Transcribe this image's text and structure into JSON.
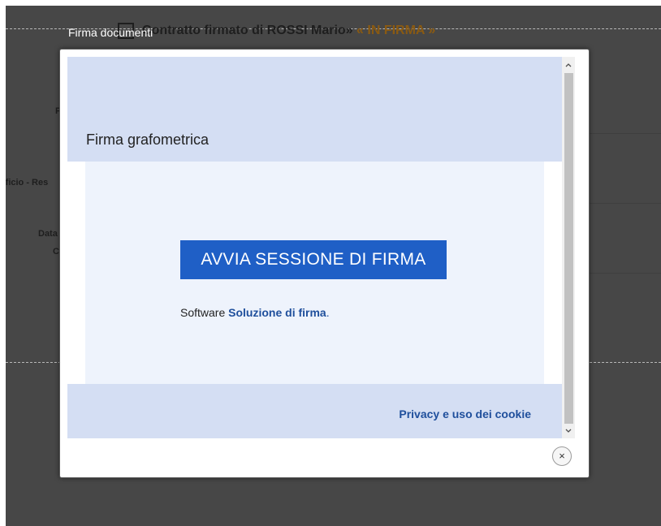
{
  "background": {
    "title": "Contratto firmato di ROSSI Mario»",
    "status": "« IN FIRMA »",
    "labels": [
      "P",
      "fficio - Res",
      "Data",
      "C"
    ]
  },
  "dialog": {
    "title": "Firma documenti",
    "header_title": "Firma grafometrica",
    "start_button": "AVVIA SESSIONE DI FIRMA",
    "software_prefix": "Software",
    "software_link": "Soluzione di firma",
    "software_suffix": ".",
    "privacy_link": "Privacy e uso dei cookie",
    "close_symbol": "×"
  },
  "colors": {
    "overlay": "#474747",
    "header_panel": "#d4def3",
    "body_panel": "#eef3fc",
    "primary_button": "#1f5fc6",
    "link": "#1f4f9c",
    "status": "#8a5a12"
  },
  "icons": [
    "close-icon",
    "chevron-up-icon",
    "chevron-down-icon"
  ]
}
